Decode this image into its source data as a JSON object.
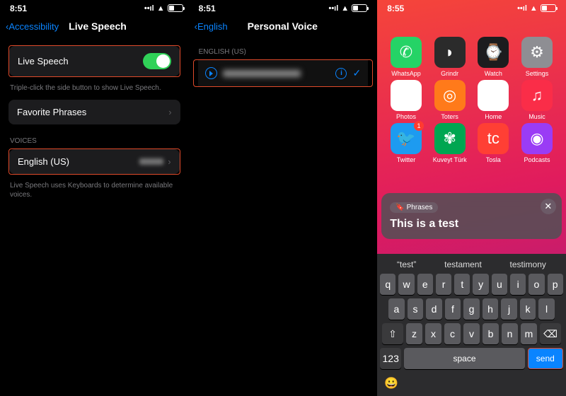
{
  "status": {
    "time1": "8:51",
    "time2": "8:51",
    "time3": "8:55",
    "battery": "38",
    "signal": "••ıl",
    "wifi": "􀙇"
  },
  "s1": {
    "back": "Accessibility",
    "title": "Live Speech",
    "row_live": "Live Speech",
    "foot_live": "Triple-click the side button to show Live Speech.",
    "row_fav": "Favorite Phrases",
    "hdr_voices": "VOICES",
    "row_eng": "English (US)",
    "foot_voices": "Live Speech uses Keyboards to determine available voices."
  },
  "s2": {
    "back": "English",
    "title": "Personal Voice",
    "hdr": "ENGLISH (US)"
  },
  "s3": {
    "apps": [
      {
        "n": "WhatsApp",
        "c": "#25d366",
        "g": "✆"
      },
      {
        "n": "Grindr",
        "c": "#2b2b2b",
        "g": "◗"
      },
      {
        "n": "Watch",
        "c": "#1c1c1e",
        "g": "⌚"
      },
      {
        "n": "Settings",
        "c": "#8e8e93",
        "g": "⚙"
      },
      {
        "n": "Photos",
        "c": "#fff",
        "g": "✿"
      },
      {
        "n": "Toters",
        "c": "#ff7a1a",
        "g": "◎"
      },
      {
        "n": "Home",
        "c": "#fff",
        "g": "⌂"
      },
      {
        "n": "Music",
        "c": "#fa2d48",
        "g": "♫"
      },
      {
        "n": "Twitter",
        "c": "#1d9bf0",
        "g": "🐦",
        "b": "1"
      },
      {
        "n": "Kuveyt Türk",
        "c": "#00a651",
        "g": "✾"
      },
      {
        "n": "Tosla",
        "c": "#ff3f34",
        "g": "tc"
      },
      {
        "n": "Podcasts",
        "c": "#9a3cf5",
        "g": "◉"
      }
    ],
    "tag": "Phrases",
    "typed": "This is a test",
    "sugg": [
      "test",
      "testament",
      "testimony"
    ],
    "krows": [
      [
        "q",
        "w",
        "e",
        "r",
        "t",
        "y",
        "u",
        "i",
        "o",
        "p"
      ],
      [
        "a",
        "s",
        "d",
        "f",
        "g",
        "h",
        "j",
        "k",
        "l"
      ],
      [
        "z",
        "x",
        "c",
        "v",
        "b",
        "n",
        "m"
      ]
    ],
    "shift": "⇧",
    "del": "⌫",
    "num": "123",
    "space": "space",
    "send": "send"
  }
}
